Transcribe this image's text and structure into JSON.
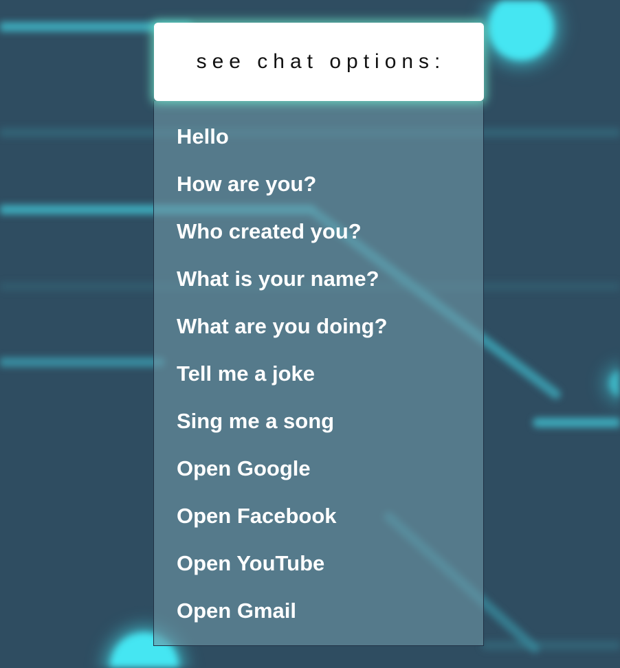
{
  "header": {
    "title": "see chat options:"
  },
  "options": [
    {
      "label": "Hello"
    },
    {
      "label": "How are you?"
    },
    {
      "label": "Who created you?"
    },
    {
      "label": "What is your name?"
    },
    {
      "label": "What are you doing?"
    },
    {
      "label": "Tell me a joke"
    },
    {
      "label": "Sing me a song"
    },
    {
      "label": "Open Google"
    },
    {
      "label": "Open Facebook"
    },
    {
      "label": "Open YouTube"
    },
    {
      "label": "Open Gmail"
    }
  ],
  "colors": {
    "background": "#2f4d61",
    "circuit": "#3fb8c9",
    "glow": "#45e6f2",
    "header_bg": "#ffffff",
    "header_glow": "#6ee6c8"
  }
}
